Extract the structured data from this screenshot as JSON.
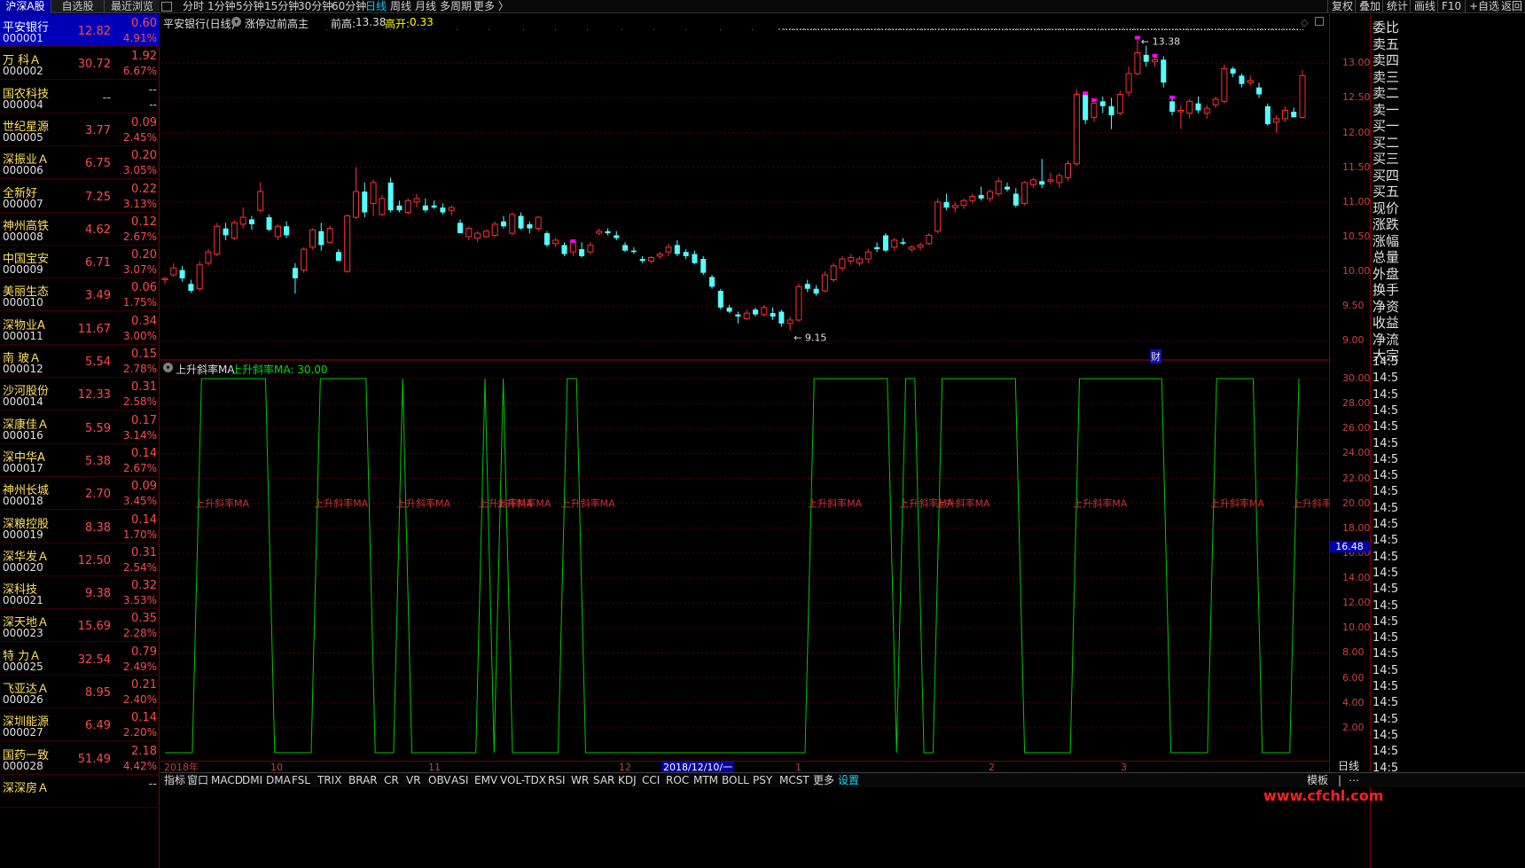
{
  "left_tabs": [
    "沪深A股",
    "自选股",
    "最近浏览"
  ],
  "stocks": [
    {
      "name": "平安银行",
      "code": "000001",
      "price": "12.82",
      "change": "0.60",
      "pct": "4.91%"
    },
    {
      "name": "万 科Ａ",
      "code": "000002",
      "price": "30.72",
      "change": "1.92",
      "pct": "6.67%"
    },
    {
      "name": "国农科技",
      "code": "000004",
      "price": "--",
      "change": "--",
      "pct": "--"
    },
    {
      "name": "世纪星源",
      "code": "000005",
      "price": "3.77",
      "change": "0.09",
      "pct": "2.45%"
    },
    {
      "name": "深振业Ａ",
      "code": "000006",
      "price": "6.75",
      "change": "0.20",
      "pct": "3.05%"
    },
    {
      "name": "全新好",
      "code": "000007",
      "price": "7.25",
      "change": "0.22",
      "pct": "3.13%"
    },
    {
      "name": "神州高铁",
      "code": "000008",
      "price": "4.62",
      "change": "0.12",
      "pct": "2.67%"
    },
    {
      "name": "中国宝安",
      "code": "000009",
      "price": "6.71",
      "change": "0.20",
      "pct": "3.07%"
    },
    {
      "name": "美丽生态",
      "code": "000010",
      "price": "3.49",
      "change": "0.06",
      "pct": "1.75%"
    },
    {
      "name": "深物业A",
      "code": "000011",
      "price": "11.67",
      "change": "0.34",
      "pct": "3.00%"
    },
    {
      "name": "南 玻Ａ",
      "code": "000012",
      "price": "5.54",
      "change": "0.15",
      "pct": "2.78%"
    },
    {
      "name": "沙河股份",
      "code": "000014",
      "price": "12.33",
      "change": "0.31",
      "pct": "2.58%"
    },
    {
      "name": "深康佳Ａ",
      "code": "000016",
      "price": "5.59",
      "change": "0.17",
      "pct": "3.14%"
    },
    {
      "name": "深中华A",
      "code": "000017",
      "price": "5.38",
      "change": "0.14",
      "pct": "2.67%"
    },
    {
      "name": "神州长城",
      "code": "000018",
      "price": "2.70",
      "change": "0.09",
      "pct": "3.45%"
    },
    {
      "name": "深粮控股",
      "code": "000019",
      "price": "8.38",
      "change": "0.14",
      "pct": "1.70%"
    },
    {
      "name": "深华发Ａ",
      "code": "000020",
      "price": "12.50",
      "change": "0.31",
      "pct": "2.54%"
    },
    {
      "name": "深科技",
      "code": "000021",
      "price": "9.38",
      "change": "0.32",
      "pct": "3.53%"
    },
    {
      "name": "深天地Ａ",
      "code": "000023",
      "price": "15.69",
      "change": "0.35",
      "pct": "2.28%"
    },
    {
      "name": "特 力Ａ",
      "code": "000025",
      "price": "32.54",
      "change": "0.79",
      "pct": "2.49%"
    },
    {
      "name": "飞亚达Ａ",
      "code": "000026",
      "price": "8.95",
      "change": "0.21",
      "pct": "2.40%"
    },
    {
      "name": "深圳能源",
      "code": "000027",
      "price": "6.49",
      "change": "0.14",
      "pct": "2.20%"
    },
    {
      "name": "国药一致",
      "code": "000028",
      "price": "51.49",
      "change": "2.18",
      "pct": "4.42%"
    },
    {
      "name": "深深房Ａ",
      "code": "",
      "price": "",
      "change": "--",
      "pct": ""
    }
  ],
  "periods": [
    "分时",
    "1分钟",
    "5分钟",
    "15分钟",
    "30分钟",
    "60分钟",
    "日线",
    "周线",
    "月线",
    "多周期",
    "更多 〉"
  ],
  "right_buttons": [
    "复权",
    "叠加",
    "统计",
    "画线",
    "F10",
    "+自选",
    "返回"
  ],
  "main": {
    "title": "平安银行(日线)",
    "indicator": "涨停过前高主",
    "prev_high_label": "前高:",
    "prev_high_value": "13.38",
    "gap_label": "高开:",
    "gap_value": "0.33",
    "max_label": "13.38",
    "min_label": "9.15",
    "fin_marker": "财"
  },
  "sub": {
    "title": "上升斜率MA",
    "value_label": "上升斜率MA: 30.00",
    "cursor_value": "16.48",
    "marker_text": "上升斜率MA"
  },
  "price_axis": [
    "13.00",
    "12.50",
    "12.00",
    "11.50",
    "11.00",
    "10.50",
    "10.00",
    "9.50",
    "9.00"
  ],
  "ind_axis": [
    "30.00",
    "28.00",
    "26.00",
    "24.00",
    "22.00",
    "20.00",
    "18.00",
    "16.00",
    "14.00",
    "12.00",
    "10.00",
    "8.00",
    "6.00",
    "4.00",
    "2.00"
  ],
  "dates": [
    "2018年",
    "10",
    "11",
    "12",
    "1",
    "2",
    "3"
  ],
  "date_highlight": "2018/12/10/一",
  "period_label": "日线",
  "indicators": [
    "指标",
    "窗口",
    "MACD",
    "DMI",
    "DMA",
    "FSL",
    "TRIX",
    "BRAR",
    "CR",
    "VR",
    "OBV",
    "ASI",
    "EMV",
    "VOL-TDX",
    "RSI",
    "WR",
    "SAR",
    "KDJ",
    "CCI",
    "ROC",
    "MTM",
    "BOLL",
    "PSY",
    "MCST",
    "更多",
    "设置"
  ],
  "bottom_right": [
    "模板",
    "|",
    "⋯"
  ],
  "side_labels": [
    "委比",
    "卖五",
    "卖四",
    "卖三",
    "卖二",
    "卖一",
    "买一",
    "买二",
    "买三",
    "买四",
    "买五",
    "现价",
    "涨跌",
    "涨幅",
    "总量",
    "外盘",
    "换手",
    "净资",
    "收益",
    "净流",
    "大宗"
  ],
  "side_time": "14:5",
  "watermark": "www.cfchl.com",
  "colors": {
    "up": "#ff3030",
    "down": "#54ffff",
    "limit": "#ff00ff",
    "line": "#00c800",
    "text_red": "#d03030"
  },
  "chart_data": {
    "type": "candlestick",
    "price_range": [
      8.75,
      13.45
    ],
    "candles": [
      [
        9.88,
        9.92,
        9.82,
        9.9
      ],
      [
        9.95,
        10.12,
        9.92,
        10.05
      ],
      [
        10.02,
        10.08,
        9.85,
        9.9
      ],
      [
        9.82,
        9.88,
        9.69,
        9.72
      ],
      [
        9.75,
        10.15,
        9.72,
        10.1
      ],
      [
        10.12,
        10.32,
        10.08,
        10.28
      ],
      [
        10.25,
        10.7,
        10.22,
        10.65
      ],
      [
        10.62,
        10.7,
        10.45,
        10.52
      ],
      [
        10.48,
        10.74,
        10.45,
        10.7
      ],
      [
        10.68,
        10.92,
        10.62,
        10.78
      ],
      [
        10.75,
        10.8,
        10.6,
        10.68
      ],
      [
        10.88,
        11.28,
        10.85,
        11.15
      ],
      [
        10.78,
        10.82,
        10.58,
        10.6
      ],
      [
        10.5,
        10.68,
        10.45,
        10.65
      ],
      [
        10.65,
        10.72,
        10.48,
        10.52
      ],
      [
        10.05,
        10.12,
        9.68,
        9.9
      ],
      [
        10.02,
        10.35,
        9.98,
        10.32
      ],
      [
        10.35,
        10.62,
        10.32,
        10.6
      ],
      [
        10.58,
        10.7,
        10.3,
        10.38
      ],
      [
        10.42,
        10.66,
        10.4,
        10.62
      ],
      [
        10.28,
        10.32,
        10.15,
        10.15
      ],
      [
        10.0,
        10.82,
        9.98,
        10.8
      ],
      [
        10.78,
        11.5,
        10.75,
        11.15
      ],
      [
        11.15,
        11.28,
        10.78,
        10.85
      ],
      [
        10.98,
        11.32,
        10.8,
        11.28
      ],
      [
        10.82,
        11.1,
        10.8,
        11.05
      ],
      [
        11.28,
        11.35,
        10.85,
        10.88
      ],
      [
        10.95,
        11.02,
        10.85,
        10.88
      ],
      [
        10.85,
        11.05,
        10.82,
        11.02
      ],
      [
        11.0,
        11.12,
        10.92,
        11.05
      ],
      [
        10.95,
        11.05,
        10.85,
        10.88
      ],
      [
        10.95,
        11.02,
        10.9,
        10.92
      ],
      [
        10.92,
        10.98,
        10.82,
        10.85
      ],
      [
        10.88,
        10.95,
        10.8,
        10.92
      ],
      [
        10.7,
        10.75,
        10.55,
        10.55
      ],
      [
        10.5,
        10.65,
        10.45,
        10.62
      ],
      [
        10.48,
        10.58,
        10.42,
        10.55
      ],
      [
        10.5,
        10.6,
        10.48,
        10.58
      ],
      [
        10.52,
        10.72,
        10.5,
        10.68
      ],
      [
        10.72,
        10.8,
        10.62,
        10.65
      ],
      [
        10.55,
        10.85,
        10.52,
        10.82
      ],
      [
        10.8,
        10.85,
        10.6,
        10.62
      ],
      [
        10.68,
        10.72,
        10.55,
        10.62
      ],
      [
        10.62,
        10.8,
        10.58,
        10.78
      ],
      [
        10.55,
        10.58,
        10.35,
        10.38
      ],
      [
        10.4,
        10.48,
        10.35,
        10.45
      ],
      [
        10.38,
        10.42,
        10.22,
        10.25
      ],
      [
        10.28,
        10.45,
        10.22,
        10.42
      ],
      [
        10.32,
        10.42,
        10.2,
        10.22
      ],
      [
        10.28,
        10.42,
        10.25,
        10.38
      ],
      [
        10.55,
        10.62,
        10.52,
        10.58
      ],
      [
        10.58,
        10.62,
        10.52,
        10.55
      ],
      [
        10.52,
        10.58,
        10.45,
        10.48
      ],
      [
        10.38,
        10.42,
        10.28,
        10.3
      ],
      [
        10.3,
        10.35,
        10.25,
        10.28
      ],
      [
        10.18,
        10.22,
        10.12,
        10.15
      ],
      [
        10.15,
        10.22,
        10.12,
        10.2
      ],
      [
        10.22,
        10.28,
        10.18,
        10.25
      ],
      [
        10.28,
        10.4,
        10.22,
        10.35
      ],
      [
        10.38,
        10.45,
        10.22,
        10.25
      ],
      [
        10.28,
        10.32,
        10.18,
        10.22
      ],
      [
        10.25,
        10.3,
        10.1,
        10.12
      ],
      [
        10.18,
        10.22,
        9.95,
        9.98
      ],
      [
        9.92,
        9.95,
        9.75,
        9.78
      ],
      [
        9.72,
        9.75,
        9.45,
        9.48
      ],
      [
        9.48,
        9.52,
        9.4,
        9.42
      ],
      [
        9.38,
        9.42,
        9.25,
        9.35
      ],
      [
        9.32,
        9.45,
        9.3,
        9.4
      ],
      [
        9.45,
        9.48,
        9.35,
        9.38
      ],
      [
        9.38,
        9.52,
        9.35,
        9.48
      ],
      [
        9.4,
        9.48,
        9.3,
        9.35
      ],
      [
        9.42,
        9.45,
        9.2,
        9.25
      ],
      [
        9.25,
        9.35,
        9.15,
        9.3
      ],
      [
        9.3,
        9.82,
        9.28,
        9.78
      ],
      [
        9.82,
        9.88,
        9.7,
        9.75
      ],
      [
        9.75,
        9.8,
        9.65,
        9.68
      ],
      [
        9.72,
        10.0,
        9.7,
        9.95
      ],
      [
        9.88,
        10.12,
        9.85,
        10.08
      ],
      [
        10.05,
        10.22,
        10.0,
        10.18
      ],
      [
        10.15,
        10.25,
        10.1,
        10.2
      ],
      [
        10.12,
        10.22,
        10.08,
        10.18
      ],
      [
        10.18,
        10.32,
        10.12,
        10.28
      ],
      [
        10.35,
        10.42,
        10.28,
        10.32
      ],
      [
        10.52,
        10.55,
        10.28,
        10.3
      ],
      [
        10.35,
        10.48,
        10.3,
        10.45
      ],
      [
        10.42,
        10.48,
        10.38,
        10.4
      ],
      [
        10.32,
        10.38,
        10.28,
        10.35
      ],
      [
        10.35,
        10.42,
        10.3,
        10.38
      ],
      [
        10.4,
        10.55,
        10.38,
        10.52
      ],
      [
        10.58,
        11.05,
        10.55,
        11.0
      ],
      [
        11.0,
        11.12,
        10.88,
        10.92
      ],
      [
        10.92,
        11.0,
        10.85,
        10.95
      ],
      [
        10.95,
        11.05,
        10.9,
        11.02
      ],
      [
        11.02,
        11.12,
        10.98,
        11.08
      ],
      [
        11.1,
        11.22,
        11.02,
        11.05
      ],
      [
        11.05,
        11.18,
        11.0,
        11.15
      ],
      [
        11.12,
        11.35,
        11.08,
        11.3
      ],
      [
        11.22,
        11.28,
        11.15,
        11.18
      ],
      [
        11.12,
        11.2,
        10.92,
        10.95
      ],
      [
        10.98,
        11.3,
        10.95,
        11.28
      ],
      [
        11.25,
        11.35,
        11.2,
        11.32
      ],
      [
        11.3,
        11.62,
        11.2,
        11.25
      ],
      [
        11.3,
        11.42,
        11.25,
        11.32
      ],
      [
        11.28,
        11.42,
        11.2,
        11.38
      ],
      [
        11.35,
        11.6,
        11.3,
        11.55
      ],
      [
        11.55,
        12.62,
        11.52,
        12.55
      ],
      [
        12.55,
        12.58,
        12.12,
        12.18
      ],
      [
        12.22,
        12.48,
        12.15,
        12.42
      ],
      [
        12.45,
        12.52,
        12.28,
        12.38
      ],
      [
        12.38,
        12.5,
        12.05,
        12.25
      ],
      [
        12.28,
        12.6,
        12.25,
        12.55
      ],
      [
        12.58,
        12.95,
        12.52,
        12.85
      ],
      [
        12.85,
        13.38,
        12.82,
        13.15
      ],
      [
        13.12,
        13.25,
        12.95,
        13.02
      ],
      [
        13.02,
        13.12,
        12.95,
        13.05
      ],
      [
        13.05,
        13.1,
        12.65,
        12.72
      ],
      [
        12.45,
        12.52,
        12.25,
        12.3
      ],
      [
        12.3,
        12.4,
        12.05,
        12.32
      ],
      [
        12.28,
        12.48,
        12.2,
        12.45
      ],
      [
        12.42,
        12.52,
        12.28,
        12.32
      ],
      [
        12.28,
        12.4,
        12.2,
        12.35
      ],
      [
        12.4,
        12.52,
        12.35,
        12.48
      ],
      [
        12.45,
        12.98,
        12.42,
        12.92
      ],
      [
        12.92,
        12.95,
        12.8,
        12.85
      ],
      [
        12.82,
        12.85,
        12.65,
        12.7
      ],
      [
        12.72,
        12.82,
        12.68,
        12.75
      ],
      [
        12.65,
        12.72,
        12.5,
        12.55
      ],
      [
        12.38,
        12.42,
        12.1,
        12.12
      ],
      [
        12.15,
        12.25,
        12.0,
        12.2
      ],
      [
        12.2,
        12.38,
        12.15,
        12.32
      ],
      [
        12.3,
        12.36,
        12.22,
        12.22
      ],
      [
        12.22,
        12.9,
        12.2,
        12.82
      ]
    ],
    "limit_up_days": [
      47,
      106,
      107,
      112,
      114,
      116,
      153
    ],
    "indicator_series": [
      0,
      0,
      0,
      0,
      30,
      30,
      30,
      30,
      30,
      30,
      30,
      30,
      0,
      0,
      0,
      0,
      0,
      30,
      30,
      30,
      30,
      30,
      30,
      0,
      0,
      0,
      30,
      0,
      0,
      0,
      0,
      0,
      0,
      0,
      0,
      30,
      0,
      30,
      0,
      0,
      0,
      0,
      0,
      0,
      30,
      30,
      0,
      0,
      0,
      0,
      0,
      0,
      0,
      0,
      0,
      0,
      0,
      0,
      0,
      0,
      0,
      0,
      0,
      0,
      0,
      0,
      0,
      0,
      0,
      0,
      0,
      30,
      30,
      30,
      30,
      30,
      30,
      30,
      30,
      30,
      0,
      30,
      30,
      0,
      0,
      30,
      30,
      30,
      30,
      30,
      30,
      30,
      30,
      30,
      0,
      0,
      0,
      0,
      0,
      0,
      30,
      30,
      30,
      30,
      30,
      30,
      30,
      30,
      30,
      30,
      0,
      0,
      0,
      0,
      0,
      30,
      30,
      30,
      30,
      30,
      0,
      0,
      0,
      0,
      30
    ]
  }
}
